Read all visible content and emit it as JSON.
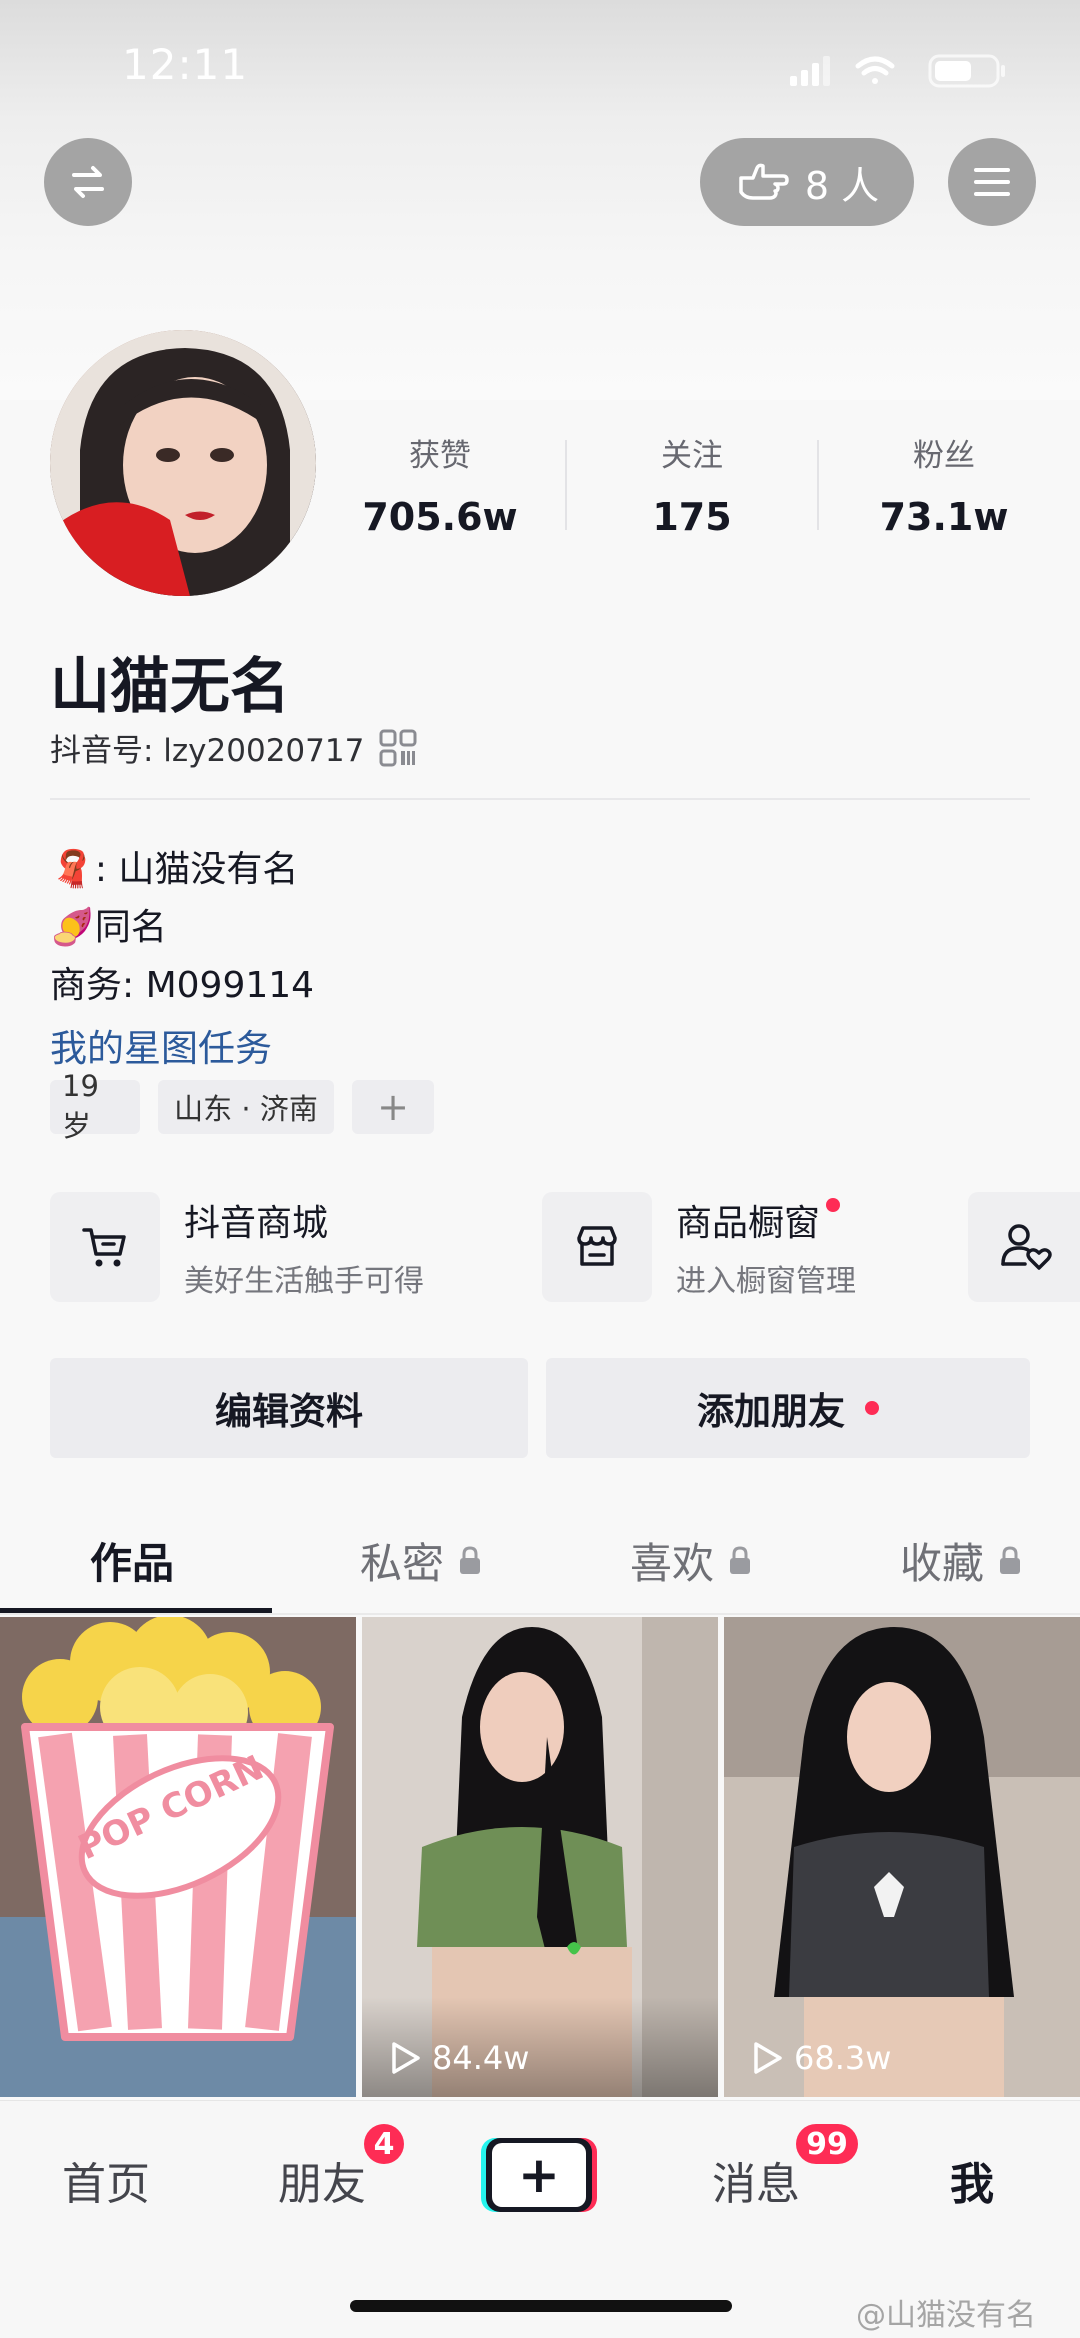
{
  "status_bar": {
    "time": "12:11"
  },
  "header": {
    "visitor_count": "8 人"
  },
  "profile": {
    "stats": [
      {
        "label": "获赞",
        "value": "705.6w"
      },
      {
        "label": "关注",
        "value": "175"
      },
      {
        "label": "粉丝",
        "value": "73.1w"
      }
    ],
    "name": "山猫无名",
    "douyin_id": "抖音号: lzy20020717",
    "bio": [
      "🧣: 山猫没有名",
      "🍠同名",
      "商务: M099114"
    ],
    "star_task_link": "我的星图任务",
    "tags": [
      "19 岁",
      "山东 · 济南",
      "+"
    ]
  },
  "services": [
    {
      "title": "抖音商城",
      "subtitle": "美好生活触手可得",
      "icon": "cart-icon"
    },
    {
      "title": "商品橱窗",
      "subtitle": "进入橱窗管理",
      "icon": "shop-window-icon"
    }
  ],
  "actions": {
    "edit_profile": "编辑资料",
    "add_friend": "添加朋友"
  },
  "tabs": [
    {
      "label": "作品",
      "locked": false
    },
    {
      "label": "私密",
      "locked": true
    },
    {
      "label": "喜欢",
      "locked": true
    },
    {
      "label": "收藏",
      "locked": true
    }
  ],
  "videos": [
    {
      "plays": "",
      "sticker": "POP CORN"
    },
    {
      "plays": "84.4w"
    },
    {
      "plays": "68.3w"
    }
  ],
  "bottom_nav": {
    "home": "首页",
    "friends": "朋友",
    "friends_badge": "4",
    "messages": "消息",
    "messages_badge": "99",
    "me": "我",
    "plus": "+"
  },
  "watermark": "@山猫没有名",
  "colors": {
    "accent_red": "#fe2c55",
    "link_blue": "#2c5a9b",
    "text_dark": "#161823"
  }
}
